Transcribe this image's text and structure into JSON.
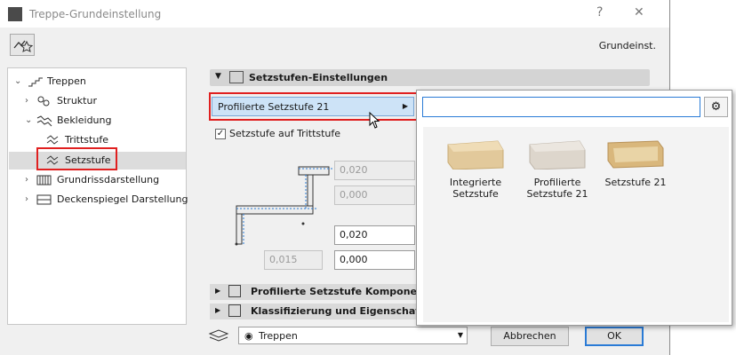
{
  "window": {
    "title": "Treppe-Grundeinstellung",
    "help_glyph": "?",
    "close_glyph": "✕",
    "preset_label": "Grundeinst."
  },
  "tree": {
    "items": [
      {
        "label": "Treppen",
        "icon": "stair-icon",
        "expanded": true
      },
      {
        "label": "Struktur",
        "icon": "structure-icon",
        "expanded": false
      },
      {
        "label": "Bekleidung",
        "icon": "cladding-icon",
        "expanded": true
      },
      {
        "label": "Trittstufe",
        "icon": "tread-icon"
      },
      {
        "label": "Setzstufe",
        "icon": "riser-icon",
        "selected": true
      },
      {
        "label": "Grundrissdarstellung",
        "icon": "floorplan-icon",
        "expanded": false
      },
      {
        "label": "Deckenspiegel Darstellung",
        "icon": "ceiling-plan-icon",
        "expanded": false
      }
    ]
  },
  "section": {
    "title": "Setzstufen-Einstellungen",
    "profile_dropdown": "Profilierte Setzstufe 21",
    "checkbox_label": "Setzstufe auf Trittstufe",
    "checkbox_checked": true,
    "fields": {
      "top_1": "0,020",
      "top_2": "0,000",
      "mid": "0,020",
      "bottom_left": "0,015",
      "bottom_right": "0,000"
    }
  },
  "collapsed_sections": [
    {
      "label": "Profilierte Setzstufe Komponenten-E"
    },
    {
      "label": "Klassifizierung und Eigenschaften"
    }
  ],
  "footer": {
    "layer": "Treppen",
    "cancel": "Abbrechen",
    "ok": "OK"
  },
  "popup": {
    "search_value": "",
    "tiles": [
      {
        "label_line1": "Integrierte",
        "label_line2": "Setzstufe"
      },
      {
        "label_line1": "Profilierte",
        "label_line2": "Setzstufe 21"
      },
      {
        "label_line1": "Setzstufe 21",
        "label_line2": ""
      }
    ]
  },
  "colors": {
    "highlight_red": "#e02020",
    "selection_blue": "#cde3f7",
    "focus_blue": "#2a7bd6",
    "wood": "#e2c99b"
  }
}
